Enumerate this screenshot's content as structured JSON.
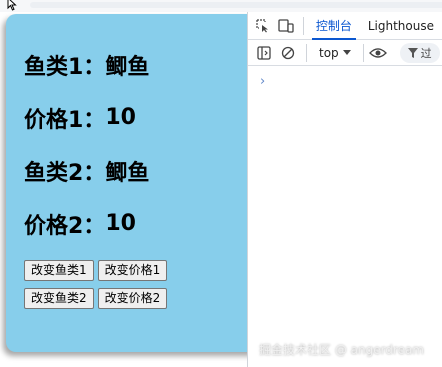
{
  "app": {
    "lines": [
      {
        "label": "鱼类1：",
        "value": "鲫鱼"
      },
      {
        "label": "价格1：",
        "value": "10"
      },
      {
        "label": "鱼类2：",
        "value": "鲫鱼"
      },
      {
        "label": "价格2：",
        "value": "10"
      }
    ],
    "buttons": {
      "change_fish1": "改变鱼类1",
      "change_price1": "改变价格1",
      "change_fish2": "改变鱼类2",
      "change_price2": "改变价格2"
    },
    "background_color": "#87ceeb"
  },
  "devtools": {
    "tabs": [
      {
        "label": "控制台",
        "active": true
      },
      {
        "label": "Lighthouse",
        "active": false
      }
    ],
    "context": "top",
    "filter_label": "过",
    "prompt": "›",
    "accent_color": "#0b57d0"
  },
  "watermark": "掘金技术社区 @ angerdream"
}
